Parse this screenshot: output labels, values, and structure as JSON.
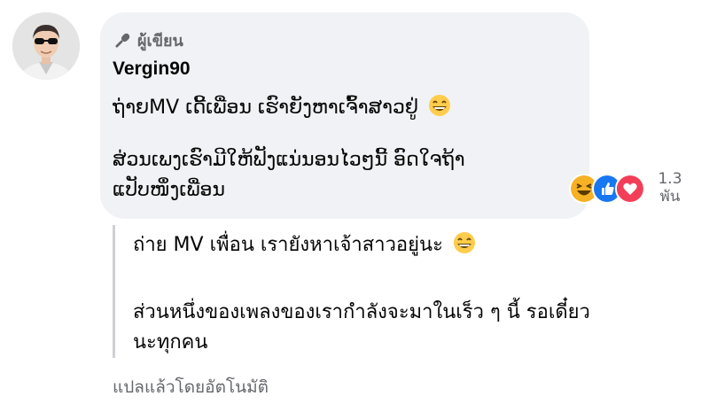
{
  "comment": {
    "author_badge": "ผู้เขียน",
    "commenter_name": "Vergin90",
    "original_lines": [
      "ຖ່າຍMV ເດີ້ເພື່ອນ ເຮົາຍັງຫາເຈົ້າສາວຢູ່",
      "ສ່ວນເພງເຮົາມີໃຫ້ຟັງແນ່ນອນໄວໆນີ້ ອົດໃຈຖ້າ",
      "ແປັບໜຶ່ງເພື່ອນ"
    ],
    "reaction_count_line1": "1.3",
    "reaction_count_line2": "พัน",
    "reactions": [
      "haha-icon",
      "like-icon",
      "love-icon"
    ]
  },
  "translation": {
    "lines": [
      "ถ่าย MV เพื่อน เรายังหาเจ้าสาวอยู่นะ",
      "ส่วนหนึ่งของเพลงของเรากำลังจะมาในเร็ว ๆ นี้ รอเดี๋ยว",
      "นะทุกคน"
    ],
    "label": "แปลแล้วโดยอัตโนมัติ"
  }
}
